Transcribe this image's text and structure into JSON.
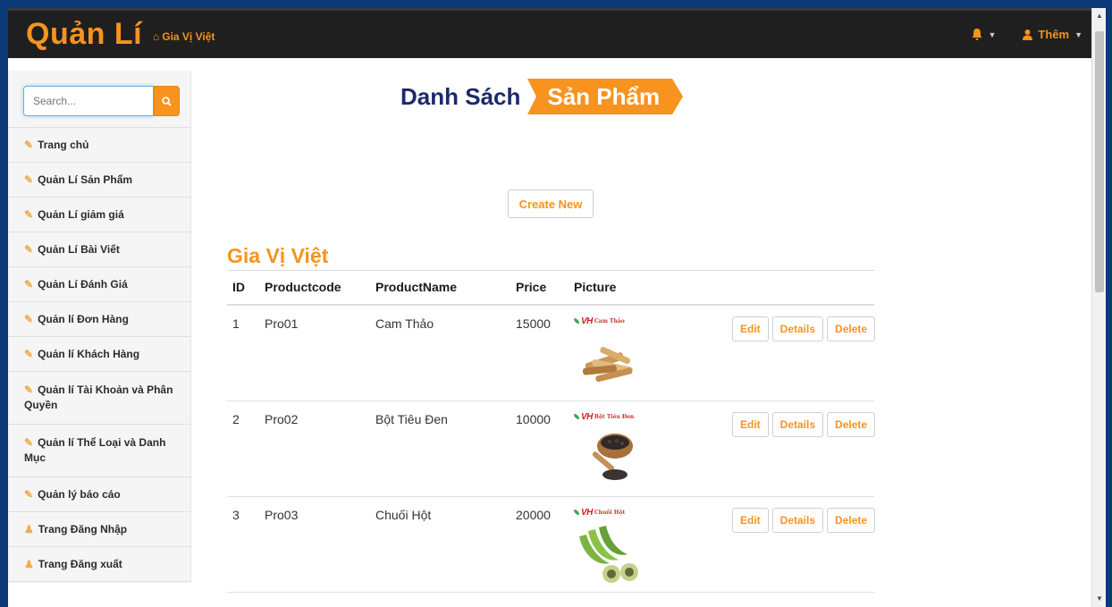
{
  "navbar": {
    "brand": "Quản Lí",
    "brand_link": "Gia Vị Việt",
    "user_menu": "Thêm"
  },
  "sidebar": {
    "search_placeholder": "Search...",
    "items": [
      {
        "label": "Trang chủ",
        "icon": "edit-icon"
      },
      {
        "label": "Quản Lí Sản Phẩm",
        "icon": "edit-icon"
      },
      {
        "label": "Quản Lí giảm giá",
        "icon": "edit-icon"
      },
      {
        "label": "Quản Lí Bài Viết",
        "icon": "edit-icon"
      },
      {
        "label": "Quản Lí Đánh Giá",
        "icon": "edit-icon"
      },
      {
        "label": "Quản lí Đơn Hàng",
        "icon": "edit-icon"
      },
      {
        "label": "Quản lí Khách Hàng",
        "icon": "edit-icon"
      },
      {
        "label": "Quản lí Tài Khoản và Phân Quyền",
        "icon": "edit-icon"
      },
      {
        "label": "Quản lí Thể Loại và Danh Mục",
        "icon": "edit-icon"
      },
      {
        "label": "Quản lý báo cáo",
        "icon": "edit-icon"
      },
      {
        "label": "Trang Đăng Nhập",
        "icon": "user-icon"
      },
      {
        "label": "Trang Đăng xuất",
        "icon": "user-icon"
      }
    ]
  },
  "main": {
    "title_part1": "Danh Sách",
    "title_part2": "Sản Phẩm",
    "create_label": "Create New",
    "section_title": "Gia Vị Việt",
    "columns": [
      "ID",
      "Productcode",
      "ProductName",
      "Price",
      "Picture"
    ],
    "rows": [
      {
        "id": "1",
        "code": "Pro01",
        "name": "Cam Thảo",
        "price": "15000",
        "picture_label": "Cam Thảo"
      },
      {
        "id": "2",
        "code": "Pro02",
        "name": "Bột Tiêu Đen",
        "price": "10000",
        "picture_label": "Bột Tiêu Đen"
      },
      {
        "id": "3",
        "code": "Pro03",
        "name": "Chuối Hột",
        "price": "20000",
        "picture_label": "Chuối Hột"
      }
    ],
    "actions": {
      "edit": "Edit",
      "details": "Details",
      "delete": "Delete"
    },
    "picture_brand": "VH"
  },
  "colors": {
    "accent": "#f7931e",
    "navbar": "#1f1f1f",
    "title": "#1b2a6b"
  }
}
